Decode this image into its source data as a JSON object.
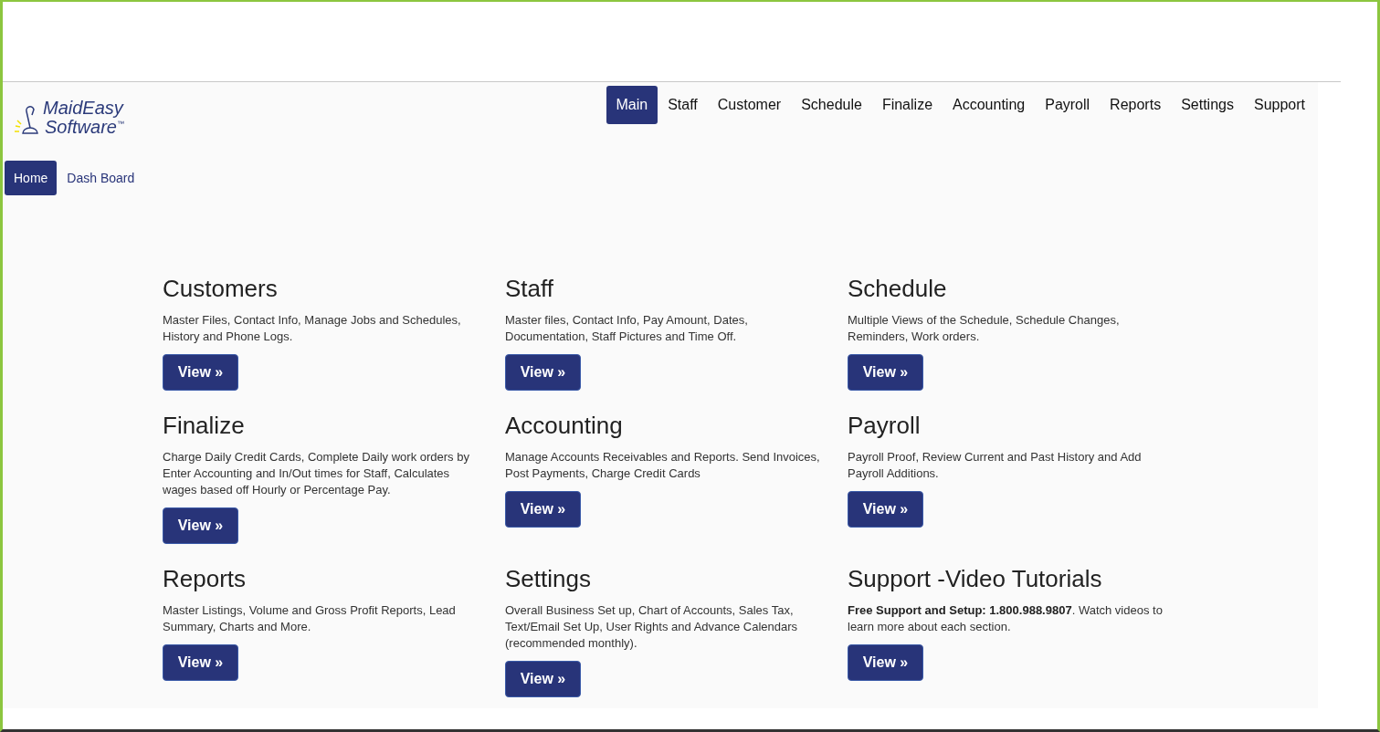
{
  "logo": {
    "line_1": "MaidEasy",
    "line_2": "Software",
    "mark": "™"
  },
  "main_nav": [
    {
      "label": "Main",
      "selected": true
    },
    {
      "label": "Staff",
      "selected": false
    },
    {
      "label": "Customer",
      "selected": false
    },
    {
      "label": "Schedule",
      "selected": false
    },
    {
      "label": "Finalize",
      "selected": false
    },
    {
      "label": "Accounting",
      "selected": false
    },
    {
      "label": "Payroll",
      "selected": false
    },
    {
      "label": "Reports",
      "selected": false
    },
    {
      "label": "Settings",
      "selected": false
    },
    {
      "label": "Support",
      "selected": false
    }
  ],
  "sub_nav": [
    {
      "label": "Home",
      "selected": true
    },
    {
      "label": "Dash Board",
      "selected": false
    }
  ],
  "sections": [
    {
      "title": "Customers",
      "description": "Master Files, Contact Info, Manage Jobs and Schedules, History and Phone Logs.",
      "button": "View »"
    },
    {
      "title": "Staff",
      "description": "Master files, Contact Info, Pay Amount, Dates, Documentation, Staff Pictures and Time Off.",
      "button": "View »"
    },
    {
      "title": "Schedule",
      "description": "Multiple Views of the Schedule, Schedule Changes, Reminders, Work orders.",
      "button": "View »"
    },
    {
      "title": "Finalize",
      "description": "Charge Daily Credit Cards, Complete Daily work orders by Enter Accounting and In/Out times for Staff, Calculates wages based off Hourly or Percentage Pay.",
      "button": "View »"
    },
    {
      "title": "Accounting",
      "description": "Manage Accounts Receivables and Reports. Send Invoices, Post Payments, Charge Credit Cards",
      "button": "View »"
    },
    {
      "title": "Payroll",
      "description": "Payroll Proof, Review Current and Past History and Add Payroll Additions.",
      "button": "View »"
    },
    {
      "title": "Reports",
      "description": "Master Listings, Volume and Gross Profit Reports, Lead Summary, Charts and More.",
      "button": "View »"
    },
    {
      "title": "Settings",
      "description": "Overall Business Set up, Chart of Accounts, Sales Tax, Text/Email Set Up, User Rights and Advance Calendars (recommended monthly).",
      "button": "View »"
    },
    {
      "title": "Support -Video Tutorials",
      "description": "**Free Support and Setup: 1.800.988.9807**. Watch videos to learn more about each section.",
      "button": "View »"
    }
  ]
}
